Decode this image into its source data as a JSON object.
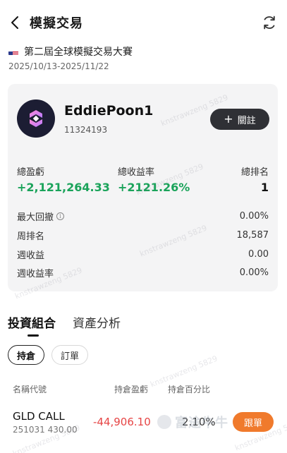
{
  "header": {
    "title": "模擬交易",
    "back_icon": "chevron-left-icon",
    "refresh_icon": "refresh-icon"
  },
  "contest": {
    "flag_icon": "us-flag-icon",
    "name": "第二屆全球模擬交易大賽",
    "dates": "2025/10/13-2025/11/22"
  },
  "profile": {
    "username": "EddiePoon1",
    "user_id": "11324193",
    "follow_label": "關註",
    "stats": {
      "total_pl_label": "總盈虧",
      "total_pl_value": "+2,121,264.33",
      "total_return_label": "總收益率",
      "total_return_value": "+2121.26%",
      "total_rank_label": "總排名",
      "total_rank_value": "1"
    },
    "metrics": [
      {
        "label": "最大回撤",
        "value": "0.00%"
      },
      {
        "label": "周排名",
        "value": "18,587"
      },
      {
        "label": "週收益",
        "value": "0.00"
      },
      {
        "label": "週收益率",
        "value": "0.00%"
      }
    ]
  },
  "tabs": {
    "portfolio": "投資組合",
    "analysis": "資產分析"
  },
  "subtabs": {
    "holdings": "持倉",
    "orders": "訂單"
  },
  "columns": {
    "name": "名稱代號",
    "pl": "持倉盈虧",
    "pct": "持倉百分比"
  },
  "positions": [
    {
      "name": "GLD CALL",
      "detail": "251031 430.00",
      "pl": "-44,906.10",
      "pct": "2.10%",
      "action": "跟單"
    }
  ],
  "watermark": {
    "text": "knstrawzeng 5829",
    "brand": "富途牛牛"
  },
  "colors": {
    "gain": "#1aa35a",
    "loss": "#e64545",
    "accent": "#f07a2c",
    "follow_button": "#2f3035"
  }
}
